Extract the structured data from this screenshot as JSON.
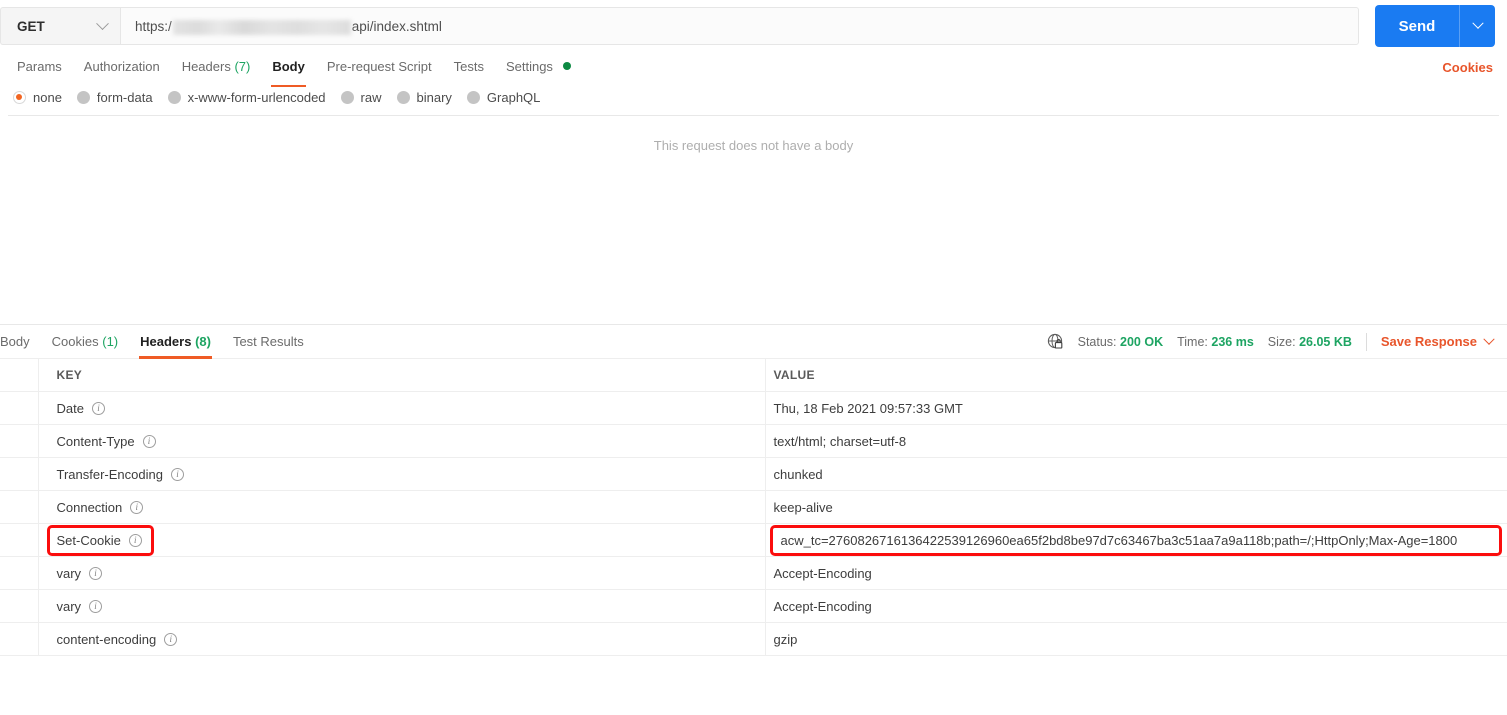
{
  "request": {
    "method": "GET",
    "url_prefix": "https:/",
    "url_redacted": "",
    "url_suffix": "api/index.shtml",
    "send_label": "Send",
    "tabs": [
      {
        "label": "Params",
        "count": "",
        "active": false
      },
      {
        "label": "Authorization",
        "count": "",
        "active": false
      },
      {
        "label": "Headers",
        "count": "(7)",
        "active": false
      },
      {
        "label": "Body",
        "count": "",
        "active": true
      },
      {
        "label": "Pre-request Script",
        "count": "",
        "active": false
      },
      {
        "label": "Tests",
        "count": "",
        "active": false
      },
      {
        "label": "Settings",
        "count": "",
        "active": false
      }
    ],
    "cookies_link": "Cookies",
    "body_types": [
      {
        "label": "none",
        "selected": true
      },
      {
        "label": "form-data",
        "selected": false
      },
      {
        "label": "x-www-form-urlencoded",
        "selected": false
      },
      {
        "label": "raw",
        "selected": false
      },
      {
        "label": "binary",
        "selected": false
      },
      {
        "label": "GraphQL",
        "selected": false
      }
    ],
    "body_empty_text": "This request does not have a body"
  },
  "response": {
    "tabs": [
      {
        "label": "Body",
        "count": "",
        "active": false
      },
      {
        "label": "Cookies",
        "count": "(1)",
        "active": false
      },
      {
        "label": "Headers",
        "count": "(8)",
        "active": true
      },
      {
        "label": "Test Results",
        "count": "",
        "active": false
      }
    ],
    "status_label": "Status:",
    "status_value": "200 OK",
    "time_label": "Time:",
    "time_value": "236 ms",
    "size_label": "Size:",
    "size_value": "26.05 KB",
    "save_response": "Save Response",
    "table": {
      "headers": [
        "KEY",
        "VALUE"
      ],
      "rows": [
        {
          "key": "Date",
          "value": "Thu, 18 Feb 2021 09:57:33 GMT",
          "highlighted": false
        },
        {
          "key": "Content-Type",
          "value": "text/html; charset=utf-8",
          "highlighted": false
        },
        {
          "key": "Transfer-Encoding",
          "value": "chunked",
          "highlighted": false
        },
        {
          "key": "Connection",
          "value": "keep-alive",
          "highlighted": false
        },
        {
          "key": "Set-Cookie",
          "value": "acw_tc=2760826716136422539126960ea65f2bd8be97d7c63467ba3c51aa7a9a118b;path=/;HttpOnly;Max-Age=1800",
          "highlighted": true
        },
        {
          "key": "vary",
          "value": "Accept-Encoding",
          "highlighted": false
        },
        {
          "key": "vary",
          "value": "Accept-Encoding",
          "highlighted": false
        },
        {
          "key": "content-encoding",
          "value": "gzip",
          "highlighted": false
        }
      ]
    }
  },
  "colors": {
    "accent_orange": "#ef5b25",
    "link_orange": "#e8552b",
    "send_blue": "#1a7bf2",
    "status_green": "#1da462",
    "annotation_red": "#fb0d0d"
  }
}
